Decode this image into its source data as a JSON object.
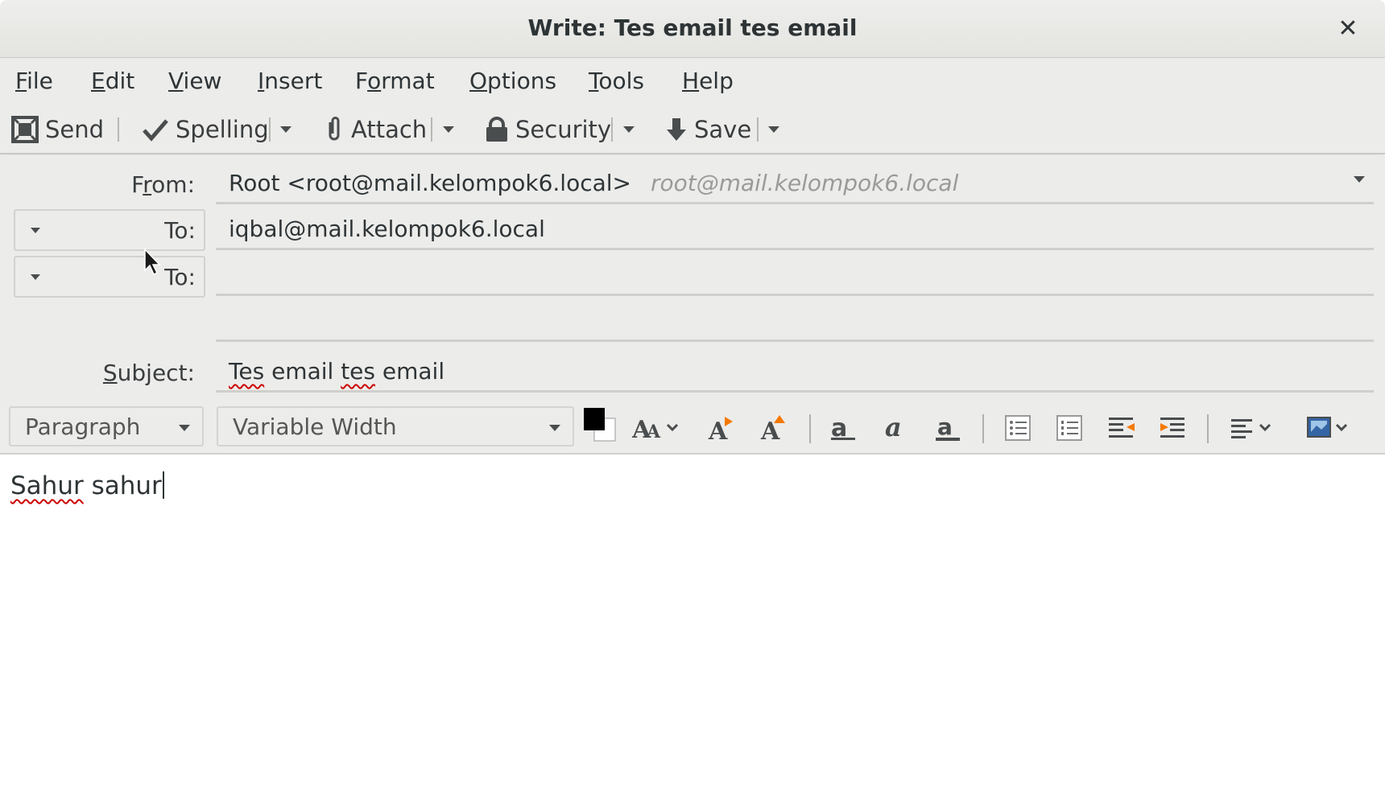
{
  "window": {
    "title": "Write: Tes email tes email",
    "close_glyph": "✕"
  },
  "menu": {
    "items": [
      {
        "mnemonic": "F",
        "rest": "ile"
      },
      {
        "mnemonic": "E",
        "rest": "dit"
      },
      {
        "mnemonic": "V",
        "rest": "iew"
      },
      {
        "mnemonic": "I",
        "rest": "nsert"
      },
      {
        "pre": "F",
        "mnemonic": "o",
        "rest": "rmat"
      },
      {
        "mnemonic": "O",
        "rest": "ptions"
      },
      {
        "mnemonic": "T",
        "rest": "ools"
      },
      {
        "mnemonic": "H",
        "rest": "elp"
      }
    ]
  },
  "toolbar": {
    "send": "Send",
    "spelling": "Spelling",
    "attach": "Attach",
    "security": "Security",
    "save": "Save"
  },
  "header": {
    "from_label_pre": "F",
    "from_label_mn": "r",
    "from_label_rest": "om:",
    "from_identity": "Root <root@mail.kelompok6.local>",
    "from_email": "root@mail.kelompok6.local",
    "to_label": "To:",
    "recipient_1": "iqbal@mail.kelompok6.local",
    "recipient_2": "",
    "subject_label_mn": "S",
    "subject_label_rest": "ubject:",
    "subject_word1": "Tes",
    "subject_word2": " email ",
    "subject_word3": "tes",
    "subject_word4": " email"
  },
  "format": {
    "paragraph": "Paragraph",
    "font": "Variable Width"
  },
  "body": {
    "word1": "Sahur",
    "word2": " sahur"
  },
  "colors": {
    "chrome": "#ececea",
    "text": "#2e3436",
    "spellcheck": "#cc0000",
    "indent_accent": "#f57900"
  }
}
